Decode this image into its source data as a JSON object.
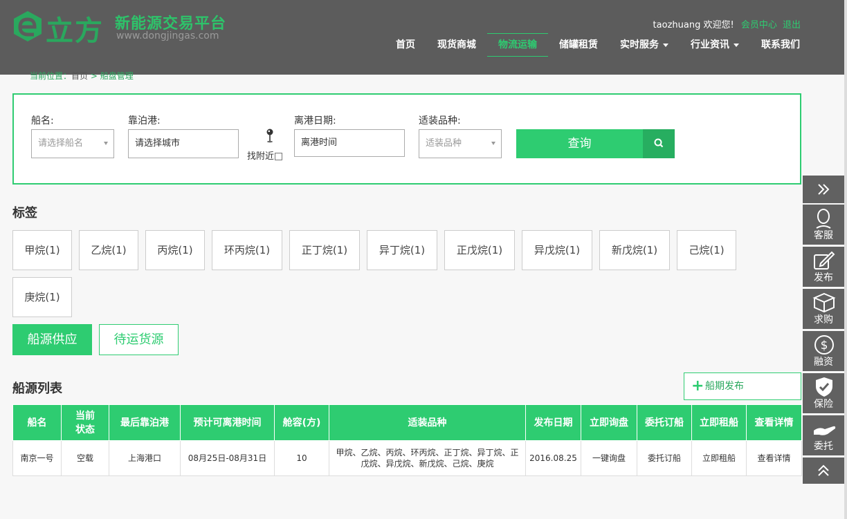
{
  "header": {
    "logo_cn": "立方",
    "logo_platform": "新能源交易平台",
    "logo_url": "www.dongjingas.com",
    "username": "taozhuang",
    "welcome": "欢迎您!",
    "member_center": "会员中心",
    "logout": "退出",
    "nav": [
      {
        "label": "首页"
      },
      {
        "label": "现货商城"
      },
      {
        "label": "物流运输",
        "active": true
      },
      {
        "label": "储罐租赁"
      },
      {
        "label": "实时服务",
        "dropdown": true
      },
      {
        "label": "行业资讯",
        "dropdown": true
      },
      {
        "label": "联系我们"
      }
    ]
  },
  "breadcrumb": {
    "prefix": "当前位置：",
    "home": "首页",
    "separator": ">",
    "current": "船盘管理"
  },
  "search": {
    "ship_label": "船名:",
    "ship_placeholder": "请选择船名",
    "port_label": "靠泊港:",
    "port_placeholder": "请选择城市",
    "nearby_label": "找附近",
    "date_label": "离港日期:",
    "date_placeholder": "离港时间",
    "cargo_label": "适装品种:",
    "cargo_placeholder": "适装品种",
    "submit_label": "查询"
  },
  "tags": {
    "title": "标签",
    "items": [
      "甲烷(1)",
      "乙烷(1)",
      "丙烷(1)",
      "环丙烷(1)",
      "正丁烷(1)",
      "异丁烷(1)",
      "正戊烷(1)",
      "异戊烷(1)",
      "新戊烷(1)",
      "己烷(1)",
      "庚烷(1)"
    ]
  },
  "tabs": {
    "supply": "船源供应",
    "cargo": "待运货源"
  },
  "list": {
    "title": "船源列表",
    "publish_label": "船期发布",
    "columns": [
      "船名",
      "当前状态",
      "最后靠泊港",
      "预计可离港时间",
      "舱容(方)",
      "适装品种",
      "发布日期",
      "立即询盘",
      "委托订船",
      "立即租船",
      "查看详情"
    ],
    "rows": [
      {
        "ship": "南京一号",
        "status": "空载",
        "port": "上海港口",
        "departure": "08月25日-08月31日",
        "capacity": "10",
        "cargo": "甲烷、乙烷、丙烷、环丙烷、正丁烷、异丁烷、正戊烷、异戊烷、新戊烷、己烷、庚烷",
        "date": "2016.08.25",
        "inquiry": "一键询盘",
        "entrust": "委托订船",
        "charter": "立即租船",
        "detail": "查看详情"
      }
    ]
  },
  "sidebar": {
    "items": [
      "客服",
      "发布",
      "求购",
      "融资",
      "保险",
      "委托"
    ]
  },
  "colors": {
    "brand_green": "#2ecc71",
    "header_gray": "#5c5c5c",
    "sidebar_gray": "#616161"
  }
}
